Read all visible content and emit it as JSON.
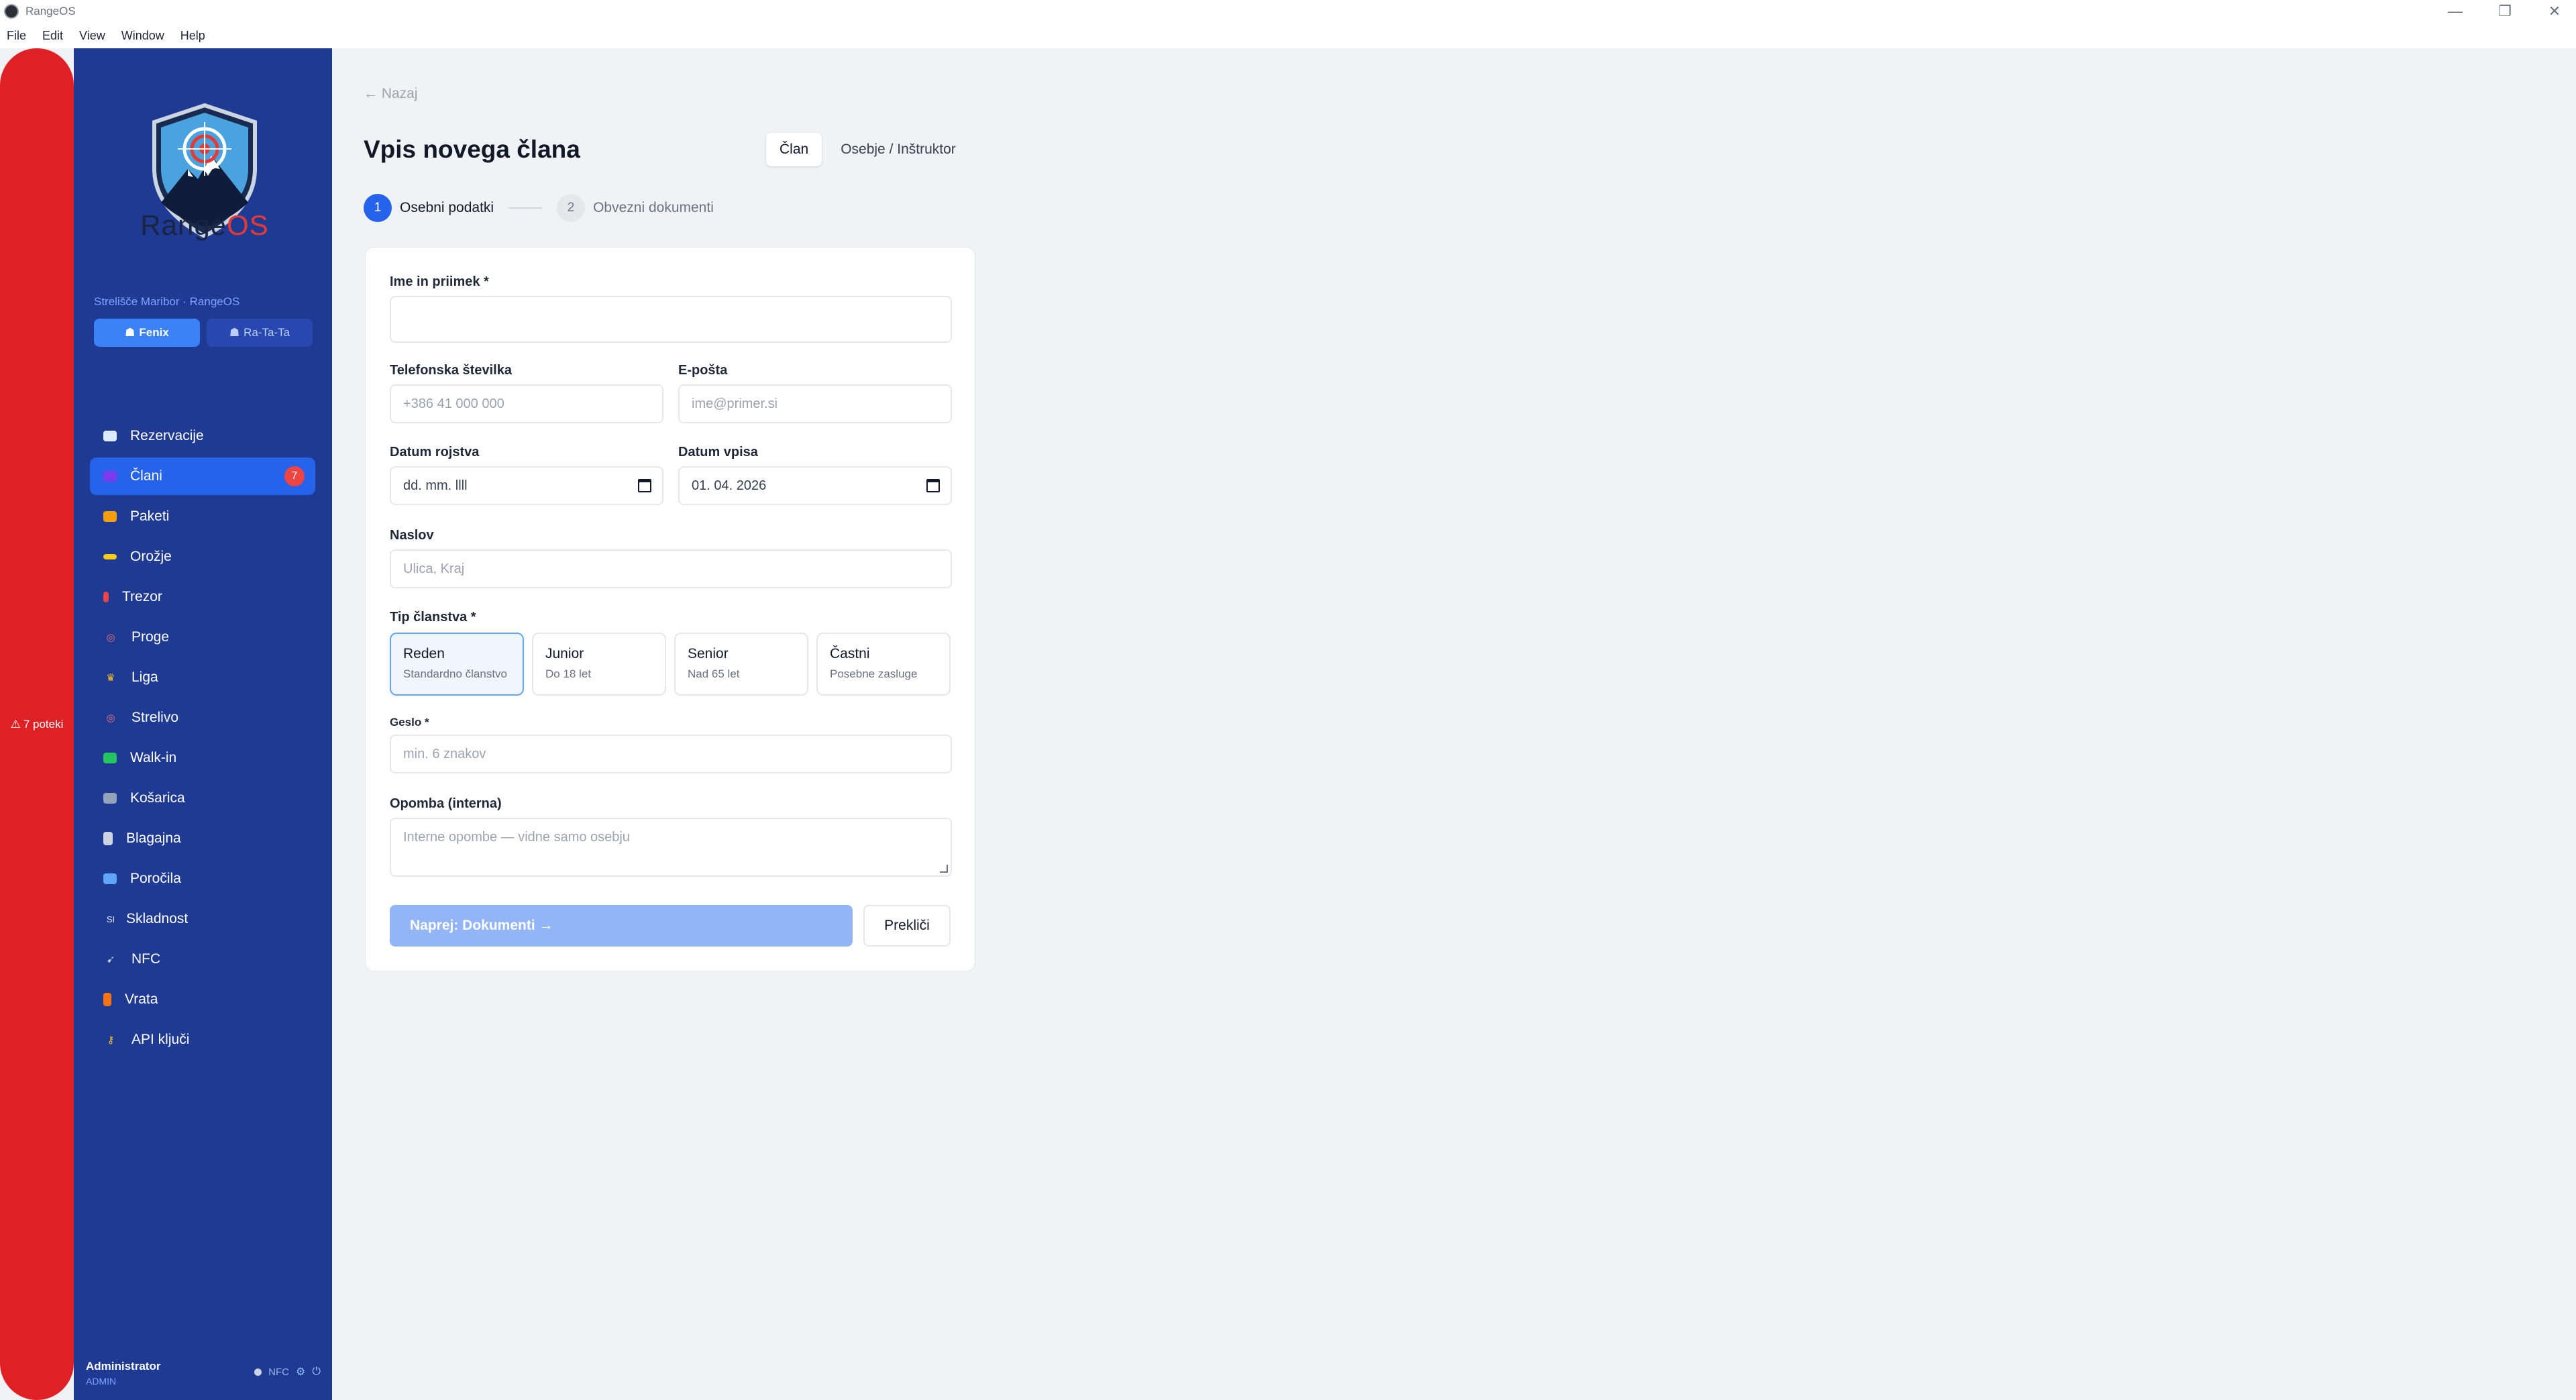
{
  "window": {
    "title": "RangeOS",
    "minimize": "—",
    "maximize": "❐",
    "close": "✕"
  },
  "menu": [
    "File",
    "Edit",
    "View",
    "Window",
    "Help"
  ],
  "alert": {
    "text": "7 poteki",
    "icon": "warning-icon"
  },
  "brand": {
    "name_a": "Range",
    "name_b": "OS",
    "accent": "#e53935"
  },
  "sidebar": {
    "org": "Strelišče Maribor · RangeOS",
    "locations": [
      {
        "label": "Fenix",
        "active": true
      },
      {
        "label": "Ra-Ta-Ta",
        "active": false
      }
    ],
    "items": [
      {
        "label": "Rezervacije",
        "icon": "calendar-icon"
      },
      {
        "label": "Člani",
        "icon": "members-icon",
        "active": true,
        "badge": "7"
      },
      {
        "label": "Paketi",
        "icon": "ticket-icon"
      },
      {
        "label": "Orožje",
        "icon": "weapon-icon"
      },
      {
        "label": "Trezor",
        "icon": "vault-icon"
      },
      {
        "label": "Proge",
        "icon": "target-icon"
      },
      {
        "label": "Liga",
        "icon": "trophy-icon"
      },
      {
        "label": "Strelivo",
        "icon": "target-icon"
      },
      {
        "label": "Walk-in",
        "icon": "cash-icon"
      },
      {
        "label": "Košarica",
        "icon": "cart-icon"
      },
      {
        "label": "Blagajna",
        "icon": "register-icon"
      },
      {
        "label": "Poročila",
        "icon": "chart-icon"
      },
      {
        "label": "Skladnost",
        "icon": "compliance-icon",
        "icon_text": "SI"
      },
      {
        "label": "NFC",
        "icon": "nfc-icon"
      },
      {
        "label": "Vrata",
        "icon": "door-icon"
      },
      {
        "label": "API ključi",
        "icon": "key-icon"
      }
    ],
    "footer": {
      "user": "Administrator",
      "role": "ADMIN",
      "nfc": "NFC",
      "settings_glyph": "⚙",
      "power_glyph": "⏻"
    }
  },
  "main": {
    "back": "← Nazaj",
    "title": "Vpis novega člana",
    "tabs": [
      {
        "label": "Član",
        "active": true
      },
      {
        "label": "Osebje / Inštruktor",
        "active": false
      }
    ],
    "steps": [
      {
        "num": "1",
        "label": "Osebni podatki",
        "active": true
      },
      {
        "num": "2",
        "label": "Obvezni dokumenti",
        "active": false
      }
    ],
    "form": {
      "name_label": "Ime in priimek *",
      "name_value": "",
      "phone_label": "Telefonska številka",
      "phone_placeholder": "+386 41 000 000",
      "email_label": "E-pošta",
      "email_placeholder": "ime@primer.si",
      "dob_label": "Datum rojstva",
      "dob_value": "dd. mm. llll",
      "enroll_label": "Datum vpisa",
      "enroll_value": "01. 04. 2026",
      "address_label": "Naslov",
      "address_placeholder": "Ulica, Kraj",
      "type_label": "Tip članstva *",
      "types": [
        {
          "title": "Reden",
          "sub": "Standardno članstvo",
          "active": true
        },
        {
          "title": "Junior",
          "sub": "Do 18 let",
          "active": false
        },
        {
          "title": "Senior",
          "sub": "Nad 65 let",
          "active": false
        },
        {
          "title": "Častni",
          "sub": "Posebne zasluge",
          "active": false
        }
      ],
      "password_label": "Geslo *",
      "password_placeholder": "min. 6 znakov",
      "note_label": "Opomba (interna)",
      "note_placeholder": "Interne opombe — vidne samo osebju",
      "next_button": "Naprej: Dokumenti →",
      "cancel_button": "Prekliči"
    }
  }
}
